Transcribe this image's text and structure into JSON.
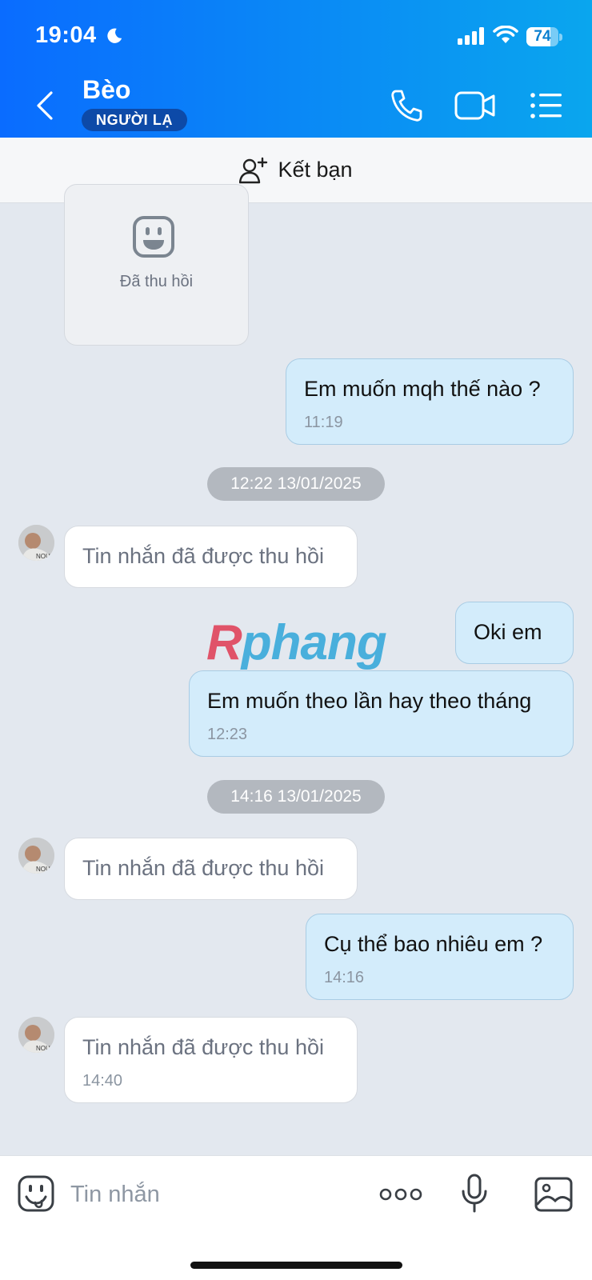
{
  "status_bar": {
    "time": "19:04",
    "battery": "74",
    "battery_level": 0.74
  },
  "header": {
    "contact_name": "Bèo",
    "badge": "NGƯỜI LẠ",
    "gradient_colors": [
      "#0a6cff",
      "#0aa6ee"
    ]
  },
  "add_friend": {
    "label": "Kết bạn"
  },
  "messages": {
    "recalled_card_label": "Đã thu hồi",
    "m1": {
      "text": "Em muốn mqh thế nào ?",
      "time": "11:19"
    },
    "date1": "12:22 13/01/2025",
    "m2": {
      "text": "Tin nhắn đã được thu hồi"
    },
    "m3": {
      "text": "Oki em"
    },
    "m4": {
      "text": "Em muốn theo lần hay theo tháng",
      "time": "12:23"
    },
    "date2": "14:16 13/01/2025",
    "m5": {
      "text": "Tin nhắn đã được thu hồi"
    },
    "m6": {
      "text": "Cụ thể bao nhiêu em ?",
      "time": "14:16"
    },
    "m7": {
      "text": "Tin nhắn đã được thu hồi",
      "time": "14:40"
    }
  },
  "watermark": {
    "part1": "R",
    "part2": "phang"
  },
  "input_bar": {
    "placeholder": "Tin nhắn"
  },
  "colors": {
    "outgoing_bubble": "#d3ecfb",
    "incoming_bubble": "#ffffff",
    "chat_background": "#e3e8ef",
    "date_chip": "#b3b8bf"
  }
}
